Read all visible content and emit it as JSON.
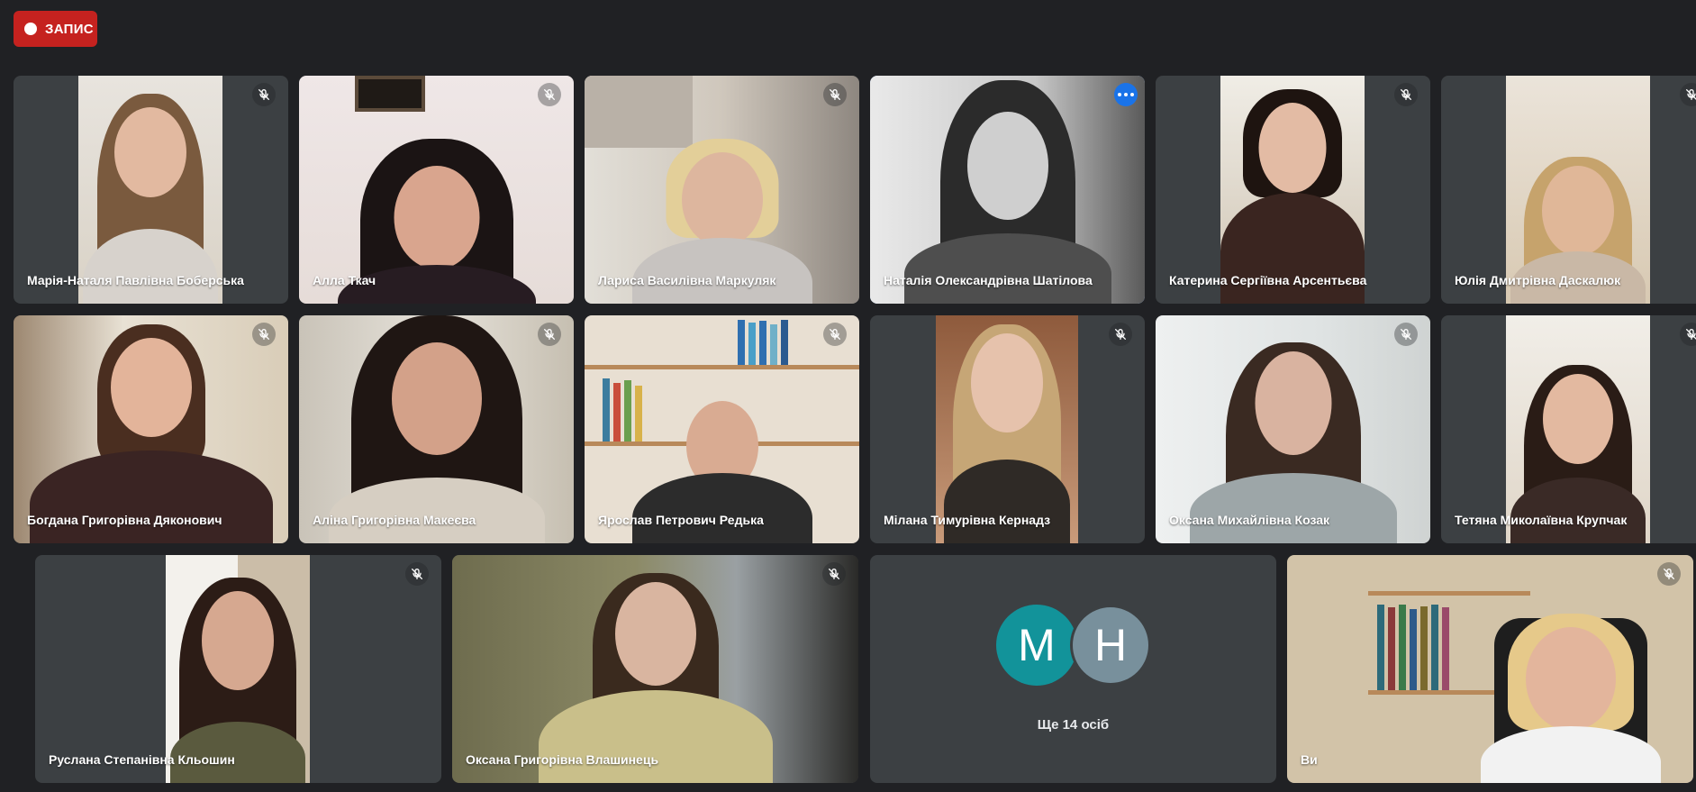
{
  "recording": {
    "label": "ЗАПИС"
  },
  "participants": [
    {
      "name": "Марія-Наталя Павлівна Боберська",
      "muted": true
    },
    {
      "name": "Алла Ткач",
      "muted": true
    },
    {
      "name": "Лариса Василівна Маркуляк",
      "muted": true
    },
    {
      "name": "Наталія Олександрівна Шатілова",
      "muted": false,
      "active": true
    },
    {
      "name": "Катерина Сергіївна Арсентьєва",
      "muted": true
    },
    {
      "name": "Юлія Дмитрівна Даскалюк",
      "muted": true
    },
    {
      "name": "Богдана Григорівна Дяконович",
      "muted": true
    },
    {
      "name": "Аліна Григорівна Макеєва",
      "muted": true
    },
    {
      "name": "Ярослав Петрович Редька",
      "muted": true
    },
    {
      "name": "Мілана Тимурівна Кернадз",
      "muted": true
    },
    {
      "name": "Оксана Михайлівна Козак",
      "muted": true
    },
    {
      "name": "Тетяна Миколаївна Крупчак",
      "muted": true
    },
    {
      "name": "Руслана Степанівна Кльошин",
      "muted": true
    },
    {
      "name": "Оксана Григорівна Влашинець",
      "muted": true
    },
    {
      "name": "Ви",
      "muted": true
    }
  ],
  "overflow": {
    "avatars": [
      {
        "letter": "M",
        "color": "#12939a"
      },
      {
        "letter": "Н",
        "color": "#78909c"
      }
    ],
    "label": "Ще 14 осіб"
  },
  "icons": {
    "mic_off": "mic-off-icon",
    "more": "more-options-icon",
    "record": "record-dot-icon"
  }
}
